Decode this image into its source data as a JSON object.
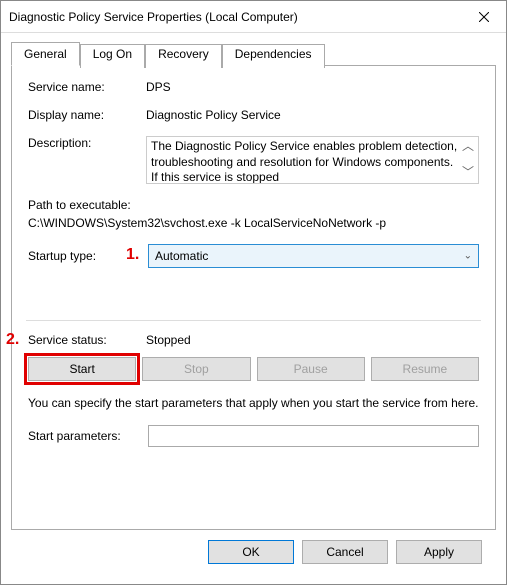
{
  "window": {
    "title": "Diagnostic Policy Service Properties (Local Computer)"
  },
  "tabs": {
    "general": "General",
    "logon": "Log On",
    "recovery": "Recovery",
    "dependencies": "Dependencies"
  },
  "general": {
    "service_name_label": "Service name:",
    "service_name_value": "DPS",
    "display_name_label": "Display name:",
    "display_name_value": "Diagnostic Policy Service",
    "description_label": "Description:",
    "description_value": "The Diagnostic Policy Service enables problem detection, troubleshooting and resolution for Windows components.  If this service is stopped",
    "path_label": "Path to executable:",
    "path_value": "C:\\WINDOWS\\System32\\svchost.exe -k LocalServiceNoNetwork -p",
    "startup_label": "Startup type:",
    "startup_value": "Automatic",
    "status_label": "Service status:",
    "status_value": "Stopped",
    "btn_start": "Start",
    "btn_stop": "Stop",
    "btn_pause": "Pause",
    "btn_resume": "Resume",
    "hint": "You can specify the start parameters that apply when you start the service from here.",
    "params_label": "Start parameters:",
    "params_value": ""
  },
  "buttons": {
    "ok": "OK",
    "cancel": "Cancel",
    "apply": "Apply"
  },
  "annotations": {
    "one": "1.",
    "two": "2."
  }
}
